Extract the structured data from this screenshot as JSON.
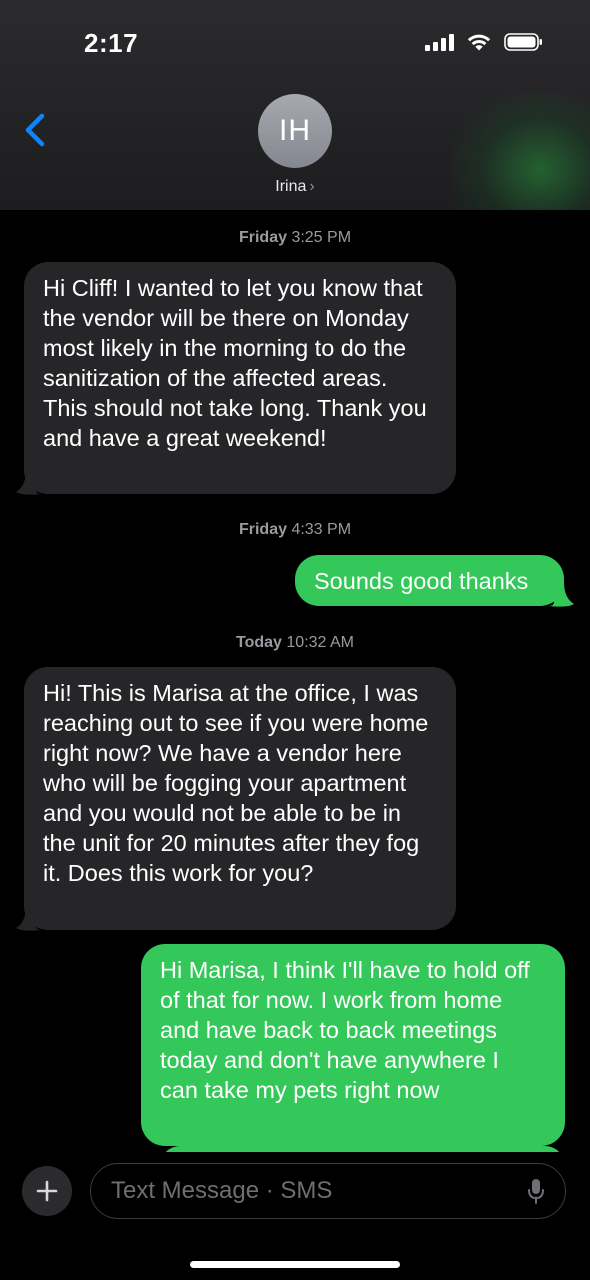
{
  "status": {
    "time": "2:17"
  },
  "header": {
    "avatar_initials": "IH",
    "contact_name": "Irina",
    "name_chevron": "›"
  },
  "messages": [
    {
      "type": "timestamp",
      "day": "Friday",
      "time": "3:25 PM"
    },
    {
      "type": "incoming",
      "text": "Hi Cliff! I wanted to let you know that the vendor will be there on Monday most likely in the morning to do the sanitization of the affected areas. This should not take long. Thank you and have a great weekend!"
    },
    {
      "type": "timestamp",
      "day": "Friday",
      "time": "4:33 PM"
    },
    {
      "type": "outgoing",
      "text": "Sounds good thanks"
    },
    {
      "type": "timestamp",
      "day": "Today",
      "time": "10:32 AM"
    },
    {
      "type": "incoming",
      "text": "Hi! This is Marisa at the office, I was reaching out to see if you were home right now? We have a vendor here who will be fogging your apartment and you would not be able to be in the unit for 20 minutes after they fog it. Does this work for you?"
    },
    {
      "type": "outgoing",
      "text": "Hi Marisa, I think I'll have to hold off of that for now. I work from home and have back to back meetings today and don't have anywhere I can take my pets right now"
    }
  ],
  "composer": {
    "placeholder": "Text Message · SMS"
  },
  "colors": {
    "outgoing": "#34c759",
    "incoming": "#262629",
    "accent": "#0a84ff"
  },
  "icons": [
    "back-chevron-icon",
    "cellular-signal-icon",
    "wifi-icon",
    "battery-icon",
    "plus-icon",
    "microphone-icon"
  ]
}
